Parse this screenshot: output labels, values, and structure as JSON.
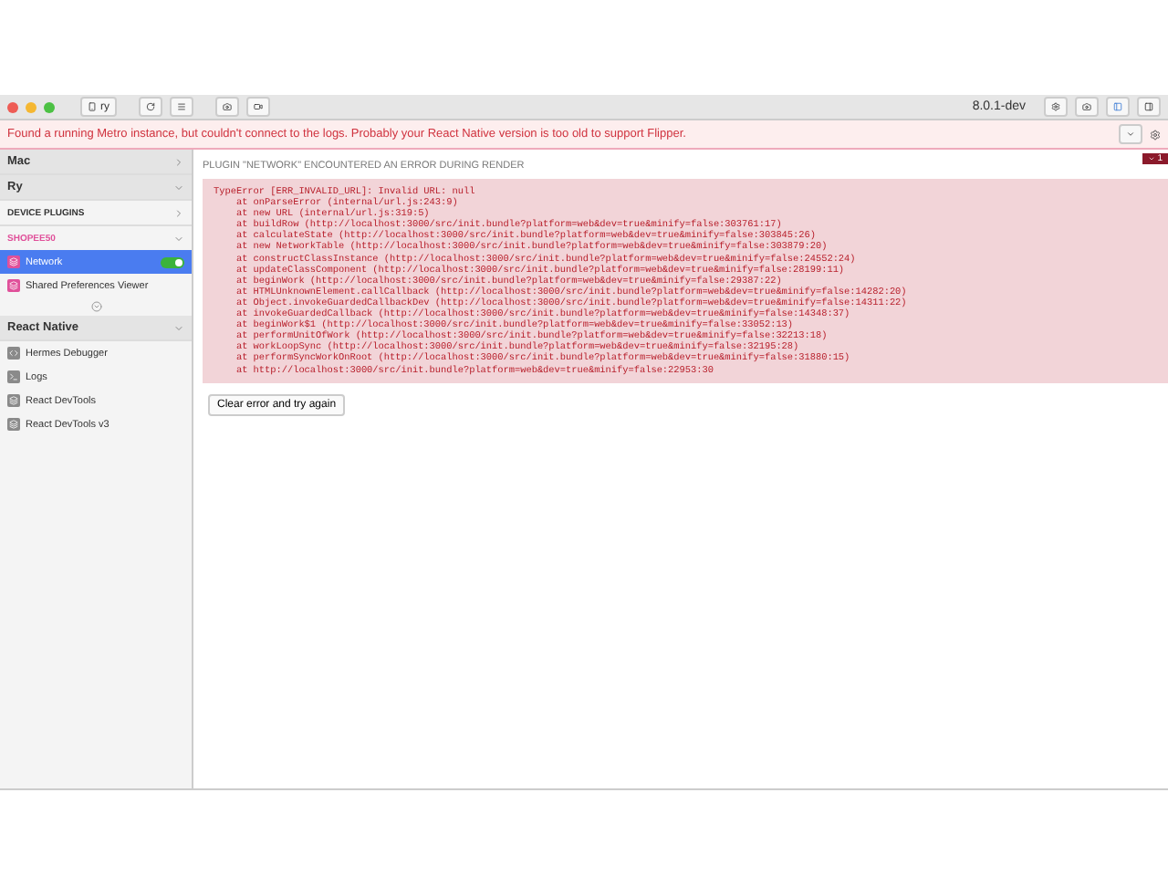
{
  "toolbar": {
    "device": "ry",
    "version": "8.0.1-dev"
  },
  "warning": "Found a running Metro instance, but couldn't connect to the logs. Probably your React Native version is too old to support Flipper.",
  "error_badge": "1",
  "sidebar": [
    {
      "label": "Mac",
      "kind": "header",
      "expanded": false
    },
    {
      "label": "Ry",
      "kind": "header",
      "expanded": true
    },
    {
      "label": "DEVICE PLUGINS",
      "kind": "section",
      "expanded": false
    },
    {
      "label": "SHOPEE50",
      "kind": "app",
      "expanded": true
    },
    {
      "label": "Network",
      "kind": "plugin",
      "selected": true,
      "on": true,
      "color": "#e0509a"
    },
    {
      "label": "Shared Preferences Viewer",
      "kind": "plugin",
      "selected": false,
      "color": "#e0509a"
    },
    {
      "kind": "more"
    },
    {
      "label": "React Native",
      "kind": "header",
      "expanded": true
    },
    {
      "label": "Hermes Debugger",
      "kind": "plugin",
      "selected": false,
      "color": "#8a8a8a"
    },
    {
      "label": "Logs",
      "kind": "plugin",
      "selected": false,
      "color": "#8a8a8a"
    },
    {
      "label": "React DevTools",
      "kind": "plugin",
      "selected": false,
      "color": "#8a8a8a"
    },
    {
      "label": "React DevTools v3",
      "kind": "plugin",
      "selected": false,
      "color": "#8a8a8a"
    }
  ],
  "error": {
    "title": "PLUGIN \"NETWORK\" ENCOUNTERED AN ERROR DURING RENDER",
    "stack": "TypeError [ERR_INVALID_URL]: Invalid URL: null\n    at onParseError (internal/url.js:243:9)\n    at new URL (internal/url.js:319:5)\n    at buildRow (http://localhost:3000/src/init.bundle?platform=web&dev=true&minify=false:303761:17)\n    at calculateState (http://localhost:3000/src/init.bundle?platform=web&dev=true&minify=false:303845:26)\n    at new NetworkTable (http://localhost:3000/src/init.bundle?platform=web&dev=true&minify=false:303879:20)\n    at constructClassInstance (http://localhost:3000/src/init.bundle?platform=web&dev=true&minify=false:24552:24)\n    at updateClassComponent (http://localhost:3000/src/init.bundle?platform=web&dev=true&minify=false:28199:11)\n    at beginWork (http://localhost:3000/src/init.bundle?platform=web&dev=true&minify=false:29387:22)\n    at HTMLUnknownElement.callCallback (http://localhost:3000/src/init.bundle?platform=web&dev=true&minify=false:14282:20)\n    at Object.invokeGuardedCallbackDev (http://localhost:3000/src/init.bundle?platform=web&dev=true&minify=false:14311:22)\n    at invokeGuardedCallback (http://localhost:3000/src/init.bundle?platform=web&dev=true&minify=false:14348:37)\n    at beginWork$1 (http://localhost:3000/src/init.bundle?platform=web&dev=true&minify=false:33052:13)\n    at performUnitOfWork (http://localhost:3000/src/init.bundle?platform=web&dev=true&minify=false:32213:18)\n    at workLoopSync (http://localhost:3000/src/init.bundle?platform=web&dev=true&minify=false:32195:28)\n    at performSyncWorkOnRoot (http://localhost:3000/src/init.bundle?platform=web&dev=true&minify=false:31880:15)\n    at http://localhost:3000/src/init.bundle?platform=web&dev=true&minify=false:22953:30",
    "button": "Clear error and try again"
  }
}
